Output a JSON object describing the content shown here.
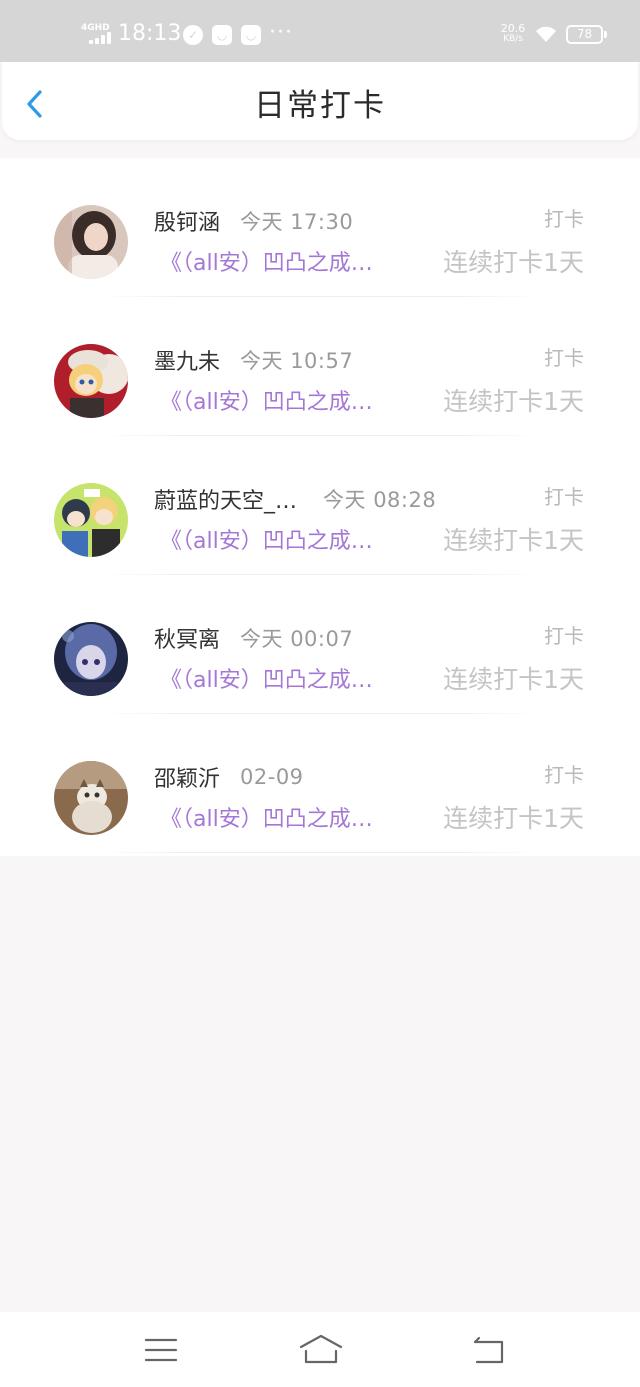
{
  "status_bar": {
    "network": "4GHD",
    "time": "18:13",
    "more": "···",
    "speed_value": "20.6",
    "speed_unit": "KB/s",
    "battery": "78"
  },
  "header": {
    "title": "日常打卡"
  },
  "rows": [
    {
      "name": "殷钶涵",
      "time": "今天  17:30",
      "tag": "打卡",
      "book": "《（all安）凹凸之成…",
      "streak": "连续打卡1天"
    },
    {
      "name": "墨九未",
      "time": "今天  10:57",
      "tag": "打卡",
      "book": "《（all安）凹凸之成…",
      "streak": "连续打卡1天"
    },
    {
      "name": "蔚蓝的天空_…",
      "time": "今天  08:28",
      "tag": "打卡",
      "book": "《（all安）凹凸之成…",
      "streak": "连续打卡1天"
    },
    {
      "name": "秋冥离",
      "time": "今天  00:07",
      "tag": "打卡",
      "book": "《（all安）凹凸之成…",
      "streak": "连续打卡1天"
    },
    {
      "name": "邵颖沂",
      "time": "02-09",
      "tag": "打卡",
      "book": "《（all安）凹凸之成…",
      "streak": "连续打卡1天"
    }
  ],
  "colors": {
    "accent": "#2f9be8",
    "book_link": "#a477d6",
    "status_bar_bg": "#d6d6d6"
  }
}
